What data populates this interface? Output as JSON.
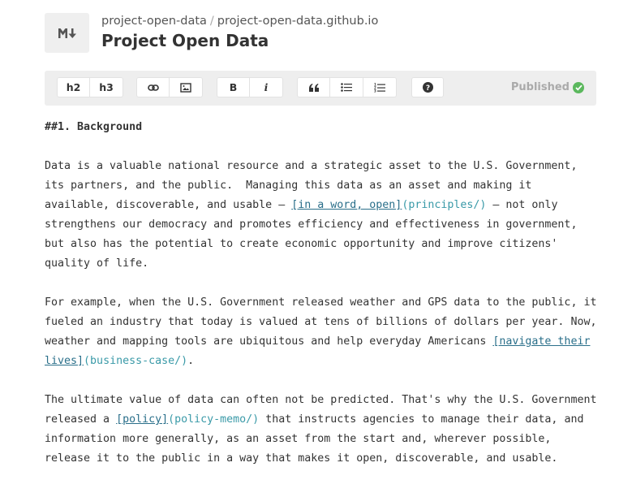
{
  "header": {
    "breadcrumb_org": "project-open-data",
    "breadcrumb_sep": "/",
    "breadcrumb_repo": "project-open-data.github.io",
    "title": "Project Open Data",
    "logo_icon": "markdown-icon"
  },
  "toolbar": {
    "h2_label": "h2",
    "h3_label": "h3",
    "bold_label": "B",
    "italic_label": "i",
    "status_label": "Published",
    "status_color": "#5bb85d",
    "icons": [
      "link-icon",
      "image-icon",
      "quote-icon",
      "bullet-list-icon",
      "numbered-list-icon",
      "help-icon",
      "check-circle-icon"
    ]
  },
  "editor": {
    "heading": "##1. Background",
    "p1": {
      "l1": "Data is a valuable national resource and a strategic asset to the U.S. Government,",
      "l2": "its partners, and the public.  Managing this data as an asset and making it",
      "l3a": "available, discoverable, and usable — ",
      "l3_link": "[in a word, open]",
      "l3_url": "(principles/)",
      "l3b": " — not only",
      "l4": "strengthens our democracy and promotes efficiency and effectiveness in government,",
      "l5": "but also has the potential to create economic opportunity and improve citizens'",
      "l6": "quality of life."
    },
    "p2": {
      "l1": "For example, when the U.S. Government released weather and GPS data to the public, it",
      "l2": "fueled an industry that today is valued at tens of billions of dollars per year. Now,",
      "l3a": "weather and mapping tools are ubiquitous and help everyday Americans ",
      "l3_link": "[navigate their",
      "l4_link": "lives]",
      "l4_url": "(business-case/)",
      "l4b": "."
    },
    "p3": {
      "l1": "The ultimate value of data can often not be predicted. That's why the U.S. Government",
      "l2a": "released a ",
      "l2_link": "[policy]",
      "l2_url": "(policy-memo/)",
      "l2b": " that instructs agencies to manage their data, and",
      "l3": "information more generally, as an asset from the start and, wherever possible,",
      "l4": "release it to the public in a way that makes it open, discoverable, and usable."
    }
  }
}
